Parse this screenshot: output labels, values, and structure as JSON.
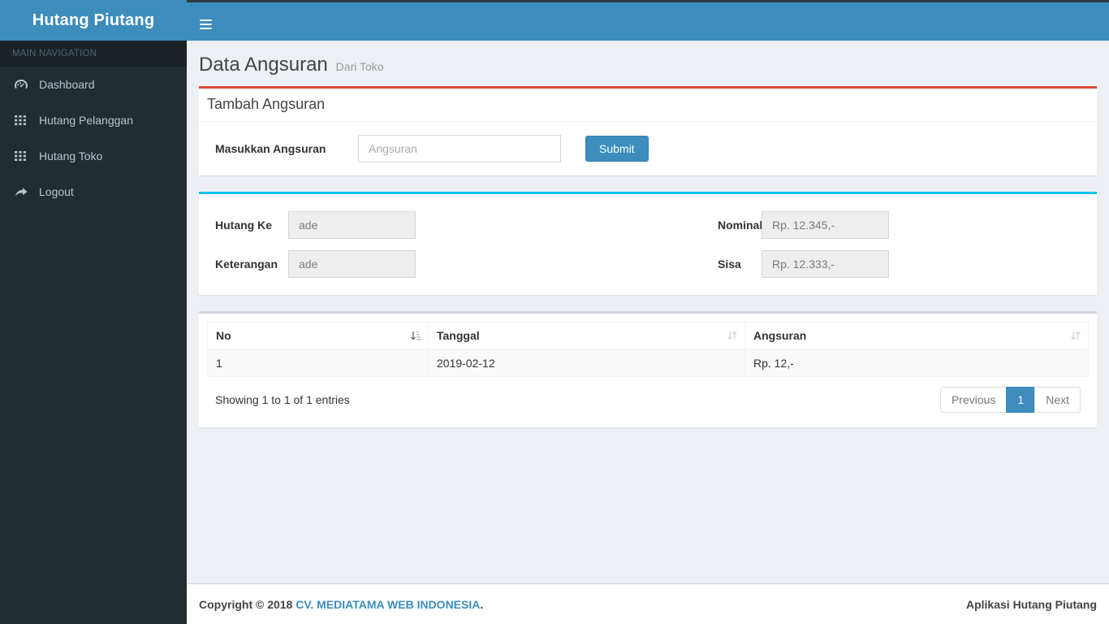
{
  "brand": {
    "title": "Hutang Piutang",
    "logo_bg": "#3c8dbc"
  },
  "header": {
    "menu_toggle_label": "Toggle navigation"
  },
  "sidebar": {
    "section_label": "MAIN NAVIGATION",
    "items": [
      {
        "label": "Dashboard",
        "icon": "dashboard-icon"
      },
      {
        "label": "Hutang Pelanggan",
        "icon": "grid-icon"
      },
      {
        "label": "Hutang Toko",
        "icon": "grid-icon"
      },
      {
        "label": "Logout",
        "icon": "logout-arrow-icon"
      }
    ]
  },
  "page": {
    "title": "Data Angsuran",
    "subtitle": "Dari Toko"
  },
  "add_box": {
    "accent_color": "#dd4b39",
    "title": "Tambah Angsuran",
    "field_label": "Masukkan Angsuran",
    "input_value": "",
    "input_placeholder": "Angsuran",
    "submit_label": "Submit"
  },
  "detail_box": {
    "accent_color": "#00c0ef",
    "fields": [
      {
        "label": "Hutang Ke",
        "value": "ade"
      },
      {
        "label": "Keterangan",
        "value": "ade"
      },
      {
        "label": "Nominal",
        "value": "Rp. 12.345,-"
      },
      {
        "label": "Sisa",
        "value": "Rp. 12.333,-"
      }
    ]
  },
  "table": {
    "accent_color": "#d2d6de",
    "columns": [
      {
        "label": "No",
        "sort": "desc"
      },
      {
        "label": "Tanggal",
        "sort": "none"
      },
      {
        "label": "Angsuran",
        "sort": "none"
      }
    ],
    "rows": [
      {
        "no": "1",
        "tanggal": "2019-02-12",
        "angsuran": "Rp. 12,-"
      }
    ],
    "info": "Showing 1 to 1 of 1 entries",
    "pagination": {
      "previous_label": "Previous",
      "next_label": "Next",
      "pages": [
        "1"
      ],
      "active_page": "1"
    }
  },
  "footer": {
    "copyright_prefix": "Copyright © 2018",
    "company_link": "CV. MEDIATAMA WEB INDONESIA",
    "copyright_suffix": ".",
    "right_text": "Aplikasi Hutang Piutang"
  }
}
